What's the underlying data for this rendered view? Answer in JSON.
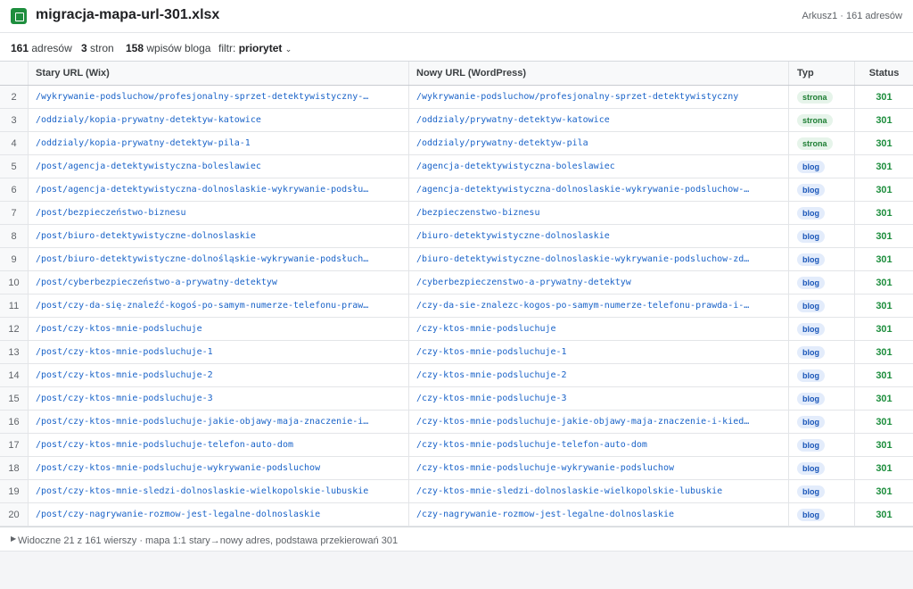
{
  "file": {
    "title": "migracja-mapa-url-301.xlsx",
    "sheet_info": "Arkusz1 · 161 adresów"
  },
  "stats": {
    "addresses_count": "161",
    "addresses_label": "adresów",
    "pages_count": "3",
    "pages_label": "stron",
    "posts_count": "158",
    "posts_label": "wpisów bloga",
    "filter_label": "filtr:",
    "filter_value": "priorytet"
  },
  "table": {
    "columns": {
      "old": "Stary URL (Wix)",
      "new": "Nowy URL (WordPress)",
      "typ": "Typ",
      "status": "Status"
    },
    "rows": [
      {
        "num": "2",
        "old": "/wykrywanie-podsluchow/profesjonalny-sprzet-detektywistyczny-…",
        "new": "/wykrywanie-podsluchow/profesjonalny-sprzet-detektywistyczny",
        "typ": "strona",
        "status": "301"
      },
      {
        "num": "3",
        "old": "/oddzialy/kopia-prywatny-detektyw-katowice",
        "new": "/oddzialy/prywatny-detektyw-katowice",
        "typ": "strona",
        "status": "301"
      },
      {
        "num": "4",
        "old": "/oddzialy/kopia-prywatny-detektyw-pila-1",
        "new": "/oddzialy/prywatny-detektyw-pila",
        "typ": "strona",
        "status": "301"
      },
      {
        "num": "5",
        "old": "/post/agencja-detektywistyczna-boleslawiec",
        "new": "/agencja-detektywistyczna-boleslawiec",
        "typ": "blog",
        "status": "301"
      },
      {
        "num": "6",
        "old": "/post/agencja-detektywistyczna-dolnoslaskie-wykrywanie-podsłu…",
        "new": "/agencja-detektywistyczna-dolnoslaskie-wykrywanie-podsluchow-…",
        "typ": "blog",
        "status": "301"
      },
      {
        "num": "7",
        "old": "/post/bezpieczeństwo-biznesu",
        "new": "/bezpieczenstwo-biznesu",
        "typ": "blog",
        "status": "301"
      },
      {
        "num": "8",
        "old": "/post/biuro-detektywistyczne-dolnoslaskie",
        "new": "/biuro-detektywistyczne-dolnoslaskie",
        "typ": "blog",
        "status": "301"
      },
      {
        "num": "9",
        "old": "/post/biuro-detektywistyczne-dolnośląskie-wykrywanie-podsłuch…",
        "new": "/biuro-detektywistyczne-dolnoslaskie-wykrywanie-podsluchow-zd…",
        "typ": "blog",
        "status": "301"
      },
      {
        "num": "10",
        "old": "/post/cyberbezpieczeństwo-a-prywatny-detektyw",
        "new": "/cyberbezpieczenstwo-a-prywatny-detektyw",
        "typ": "blog",
        "status": "301"
      },
      {
        "num": "11",
        "old": "/post/czy-da-się-znaleźć-kogoś-po-samym-numerze-telefonu-praw…",
        "new": "/czy-da-sie-znalezc-kogos-po-samym-numerze-telefonu-prawda-i-…",
        "typ": "blog",
        "status": "301"
      },
      {
        "num": "12",
        "old": "/post/czy-ktos-mnie-podsluchuje",
        "new": "/czy-ktos-mnie-podsluchuje",
        "typ": "blog",
        "status": "301"
      },
      {
        "num": "13",
        "old": "/post/czy-ktos-mnie-podsluchuje-1",
        "new": "/czy-ktos-mnie-podsluchuje-1",
        "typ": "blog",
        "status": "301"
      },
      {
        "num": "14",
        "old": "/post/czy-ktos-mnie-podsluchuje-2",
        "new": "/czy-ktos-mnie-podsluchuje-2",
        "typ": "blog",
        "status": "301"
      },
      {
        "num": "15",
        "old": "/post/czy-ktos-mnie-podsluchuje-3",
        "new": "/czy-ktos-mnie-podsluchuje-3",
        "typ": "blog",
        "status": "301"
      },
      {
        "num": "16",
        "old": "/post/czy-ktos-mnie-podsluchuje-jakie-objawy-maja-znaczenie-i…",
        "new": "/czy-ktos-mnie-podsluchuje-jakie-objawy-maja-znaczenie-i-kied…",
        "typ": "blog",
        "status": "301"
      },
      {
        "num": "17",
        "old": "/post/czy-ktos-mnie-podsluchuje-telefon-auto-dom",
        "new": "/czy-ktos-mnie-podsluchuje-telefon-auto-dom",
        "typ": "blog",
        "status": "301"
      },
      {
        "num": "18",
        "old": "/post/czy-ktos-mnie-podsluchuje-wykrywanie-podsluchow",
        "new": "/czy-ktos-mnie-podsluchuje-wykrywanie-podsluchow",
        "typ": "blog",
        "status": "301"
      },
      {
        "num": "19",
        "old": "/post/czy-ktos-mnie-sledzi-dolnoslaskie-wielkopolskie-lubuskie",
        "new": "/czy-ktos-mnie-sledzi-dolnoslaskie-wielkopolskie-lubuskie",
        "typ": "blog",
        "status": "301"
      },
      {
        "num": "20",
        "old": "/post/czy-nagrywanie-rozmow-jest-legalne-dolnoslaskie",
        "new": "/czy-nagrywanie-rozmow-jest-legalne-dolnoslaskie",
        "typ": "blog",
        "status": "301"
      }
    ]
  },
  "footer": {
    "text": "Widoczne 21 z 161 wierszy · mapa 1:1 stary→nowy adres, podstawa przekierowań 301"
  },
  "colors": {
    "accent_green": "#1e8e3e",
    "link_blue": "#1a63c8"
  },
  "icons": {
    "file": "spreadsheet-icon",
    "filter": "chevron-down-icon",
    "footer": "caret-right-icon"
  }
}
